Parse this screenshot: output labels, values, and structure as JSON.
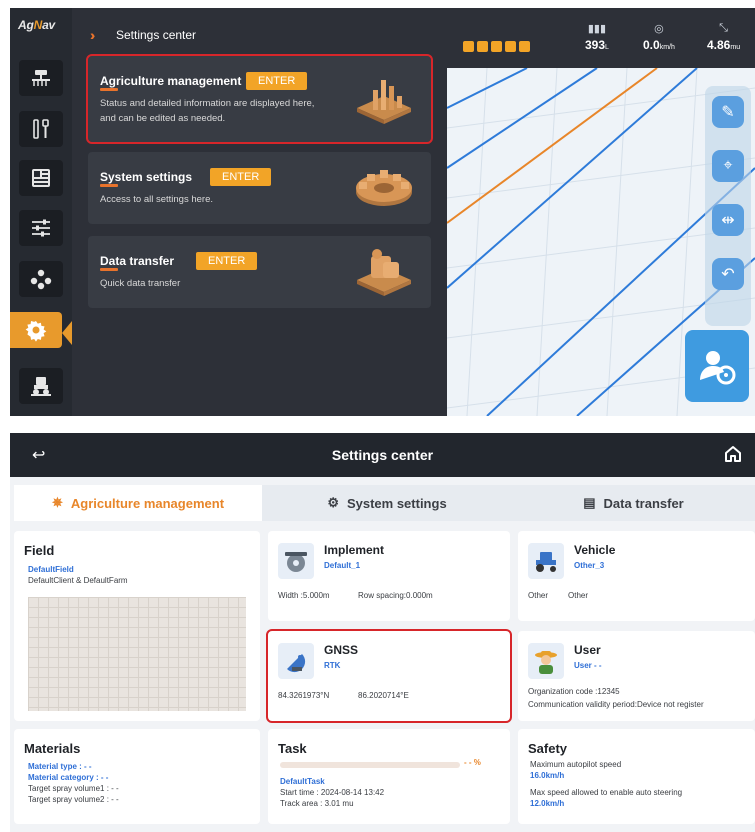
{
  "top": {
    "logo": {
      "prefix": "Ag",
      "highlight": "N",
      "suffix": "av"
    },
    "panel_title": "Settings center",
    "cards": [
      {
        "title": "Agriculture management",
        "enter": "ENTER",
        "desc1": "Status and detailed information are displayed here,",
        "desc2": "and can be edited as needed.",
        "highlighted": true
      },
      {
        "title": "System settings",
        "enter": "ENTER",
        "desc1": "Access to all settings here.",
        "desc2": "",
        "highlighted": false
      },
      {
        "title": "Data transfer",
        "enter": "ENTER",
        "desc1": "Quick data transfer",
        "desc2": "",
        "highlighted": false
      }
    ],
    "status": {
      "tank": {
        "value": "393",
        "unit": "L"
      },
      "speed": {
        "value": "0.0",
        "unit": "km/h"
      },
      "area": {
        "value": "4.86",
        "unit": "mu"
      }
    },
    "sidebar_icons": [
      "implement-icon",
      "tool-icon",
      "display-icon",
      "sliders-icon",
      "network-icon",
      "gear-icon",
      "tractor-icon"
    ],
    "map_tools": [
      "edit-path-icon",
      "map-pin-icon",
      "spacing-icon",
      "u-turn-icon"
    ],
    "colors": {
      "accent": "#f2a427",
      "highlight": "#d7262a",
      "guide_blue": "#2e7bd9",
      "guide_orange": "#e8862a"
    }
  },
  "bottom": {
    "title": "Settings center",
    "tabs": [
      {
        "label": "Agriculture management",
        "active": true
      },
      {
        "label": "System settings",
        "active": false
      },
      {
        "label": "Data transfer",
        "active": false
      }
    ],
    "field": {
      "title": "Field",
      "name": "DefaultField",
      "client": "DefaultClient & DefaultFarm"
    },
    "implement": {
      "title": "Implement",
      "name": "Default_1",
      "width": "Width :5.000m",
      "row_spacing": "Row spacing:0.000m"
    },
    "vehicle": {
      "title": "Vehicle",
      "name": "Other_3",
      "type1": "Other",
      "type2": "Other"
    },
    "gnss": {
      "title": "GNSS",
      "mode": "RTK",
      "lat": "84.3261973°N",
      "lon": "86.2020714°E"
    },
    "user": {
      "title": "User",
      "name": "User - -",
      "org": "Organization code :12345",
      "validity": "Communication validity period:Device not register"
    },
    "materials": {
      "title": "Materials",
      "type": "Material type : - -",
      "category": "Material category : - -",
      "vol1": "Target spray volume1 : - -",
      "vol2": "Target spray volume2 : - -"
    },
    "task": {
      "title": "Task",
      "progress_text": "- - %",
      "progress_fraction": 0,
      "name": "DefaultTask",
      "start": "Start time : 2024-08-14 13:42",
      "area": "Track area : 3.01 mu"
    },
    "safety": {
      "title": "Safety",
      "max_label": "Maximum autopilot speed",
      "max_value": "16.0km/h",
      "enable_label": "Max speed allowed to enable auto steering",
      "enable_value": "12.0km/h"
    }
  }
}
